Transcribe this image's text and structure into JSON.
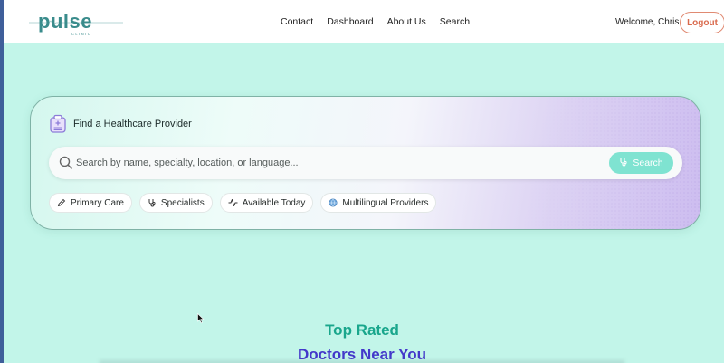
{
  "header": {
    "logo_text": "pulse",
    "logo_subtext": "CLINIC",
    "nav": [
      "Contact",
      "Dashboard",
      "About Us",
      "Search"
    ],
    "welcome": "Welcome, Chris",
    "logout_label": "Logout"
  },
  "hero": {
    "title": "Find a Healthcare Provider",
    "search_placeholder": "Search by name, specialty, location, or language...",
    "search_value": "",
    "search_button": "Search",
    "chips": [
      {
        "label": "Primary Care",
        "icon": "pencil-icon"
      },
      {
        "label": "Specialists",
        "icon": "stethoscope-icon"
      },
      {
        "label": "Available Today",
        "icon": "activity-icon"
      },
      {
        "label": "Multilingual Providers",
        "icon": "globe-icon"
      }
    ]
  },
  "section": {
    "line1": "Top Rated",
    "line2": "Doctors Near You"
  },
  "colors": {
    "background": "#c2f5e9",
    "logo_teal": "#3a8c8c",
    "logout_accent": "#d9694c",
    "search_button": "#7fe3d1",
    "title_teal": "#19a68c",
    "title_indigo": "#4338ca"
  }
}
